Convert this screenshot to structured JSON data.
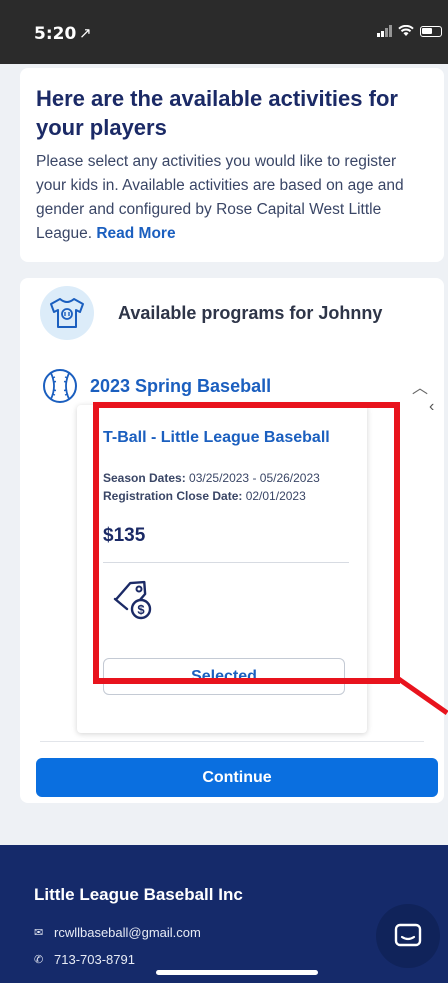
{
  "status_bar": {
    "time": "5:20",
    "location_arrow": "↗"
  },
  "intro": {
    "title": "Here are the available activities for your players",
    "text": "Please select any activities you would like to register your kids in. Available activities are based on age and gender and configured by Rose Capital West Little League.",
    "read_more": "Read More"
  },
  "programs": {
    "heading": "Available programs for Johnny",
    "season": "2023 Spring Baseball",
    "activity": {
      "title": "T-Ball - Little League Baseball",
      "season_dates_label": "Season Dates:",
      "season_dates": "03/25/2023 - 05/26/2023",
      "reg_close_label": "Registration Close Date:",
      "reg_close": "02/01/2023",
      "price": "$135",
      "selected_label": "Selected"
    },
    "continue_label": "Continue"
  },
  "footer": {
    "org": "Little League Baseball Inc",
    "email": "rcwllbaseball@gmail.com",
    "phone": "713-703-8791"
  },
  "colors": {
    "accent": "#0a6fe0",
    "navy": "#152a6a",
    "highlight": "#e8131d"
  },
  "icons": [
    "location-arrow-icon",
    "signal-icon",
    "wifi-icon",
    "battery-icon",
    "shirt-icon",
    "baseball-icon",
    "chevron-up-icon",
    "chevron-left-icon",
    "price-tag-icon",
    "mail-icon",
    "phone-icon",
    "chat-icon"
  ]
}
